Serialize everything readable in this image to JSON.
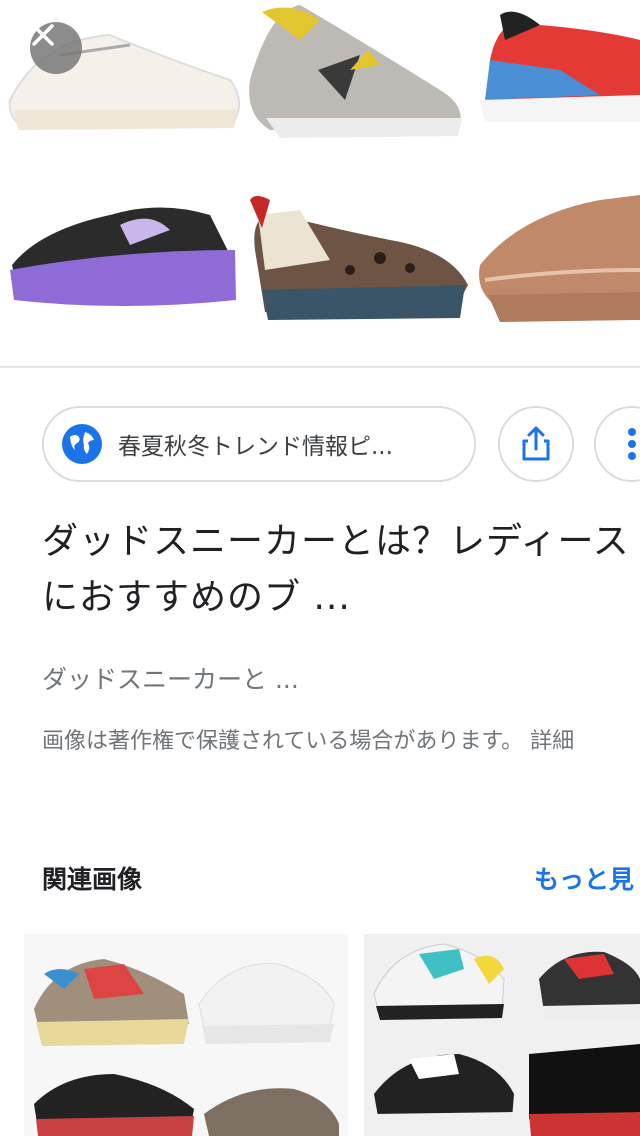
{
  "hero": {
    "shoe_colors": [
      "#f4efe6",
      "#b9b6b2",
      "#e53935",
      "#7e57c2",
      "#3e2a24",
      "#c08a6a"
    ]
  },
  "close_label": "×",
  "source": {
    "name": "春夏秋冬トレンド情報ピ...",
    "icon": "globe-icon"
  },
  "actions": {
    "share_icon": "share-icon",
    "more_icon": "more-vert-icon"
  },
  "result": {
    "title": "ダッドスニーカーとは？レディースにおすすめのブ ...",
    "subtitle": "ダッドスニーカーと ...",
    "notice": "画像は著作権で保護されている場合があります。 詳細"
  },
  "related": {
    "heading": "関連画像",
    "more_label": "もっと見"
  },
  "colors": {
    "accent": "#1a73e8",
    "border": "#dadce0",
    "muted": "#70757a"
  }
}
